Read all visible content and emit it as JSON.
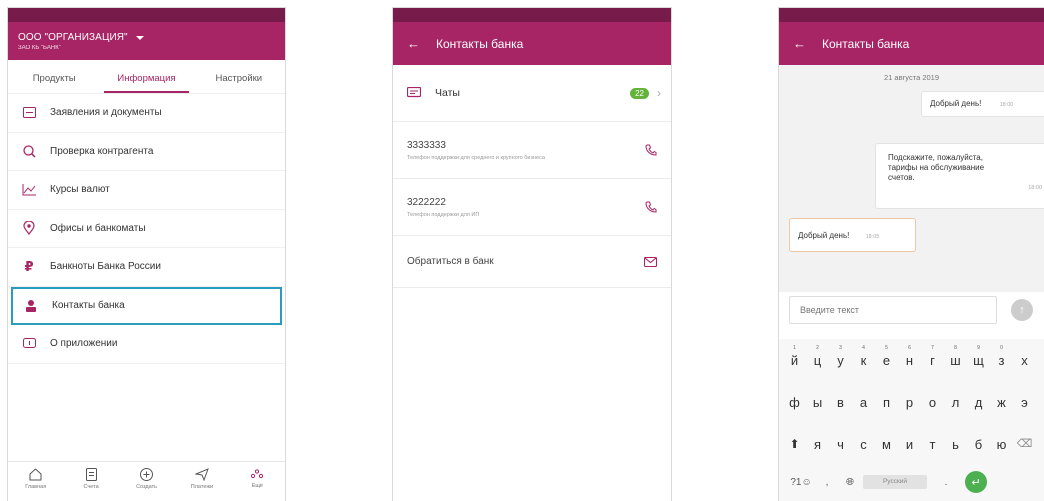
{
  "colors": {
    "brand": "#a82565",
    "statusbar": "#761b4a",
    "selection": "#2a9cbf",
    "badge": "#64b33a"
  },
  "screen1": {
    "org": {
      "name": "ООО \"ОРГАНИЗАЦИЯ\"",
      "subtitle": "ЗАО КБ \"БАНК\""
    },
    "tabs": [
      {
        "label": "Продукты"
      },
      {
        "label": "Информация",
        "active": true
      },
      {
        "label": "Настройки"
      }
    ],
    "menu": [
      {
        "label": "Заявления и документы",
        "icon": "document-icon"
      },
      {
        "label": "Проверка контрагента",
        "icon": "search-check-icon"
      },
      {
        "label": "Курсы валют",
        "icon": "chart-icon"
      },
      {
        "label": "Офисы и банкоматы",
        "icon": "location-icon"
      },
      {
        "label": "Банкноты Банка России",
        "icon": "ruble-icon"
      },
      {
        "label": "Контакты банка",
        "icon": "contacts-icon",
        "selected": true
      },
      {
        "label": "О приложении",
        "icon": "info-icon"
      }
    ],
    "bottom_nav": [
      {
        "label": "Главная",
        "icon": "home-icon"
      },
      {
        "label": "Счета",
        "icon": "accounts-icon"
      },
      {
        "label": "Создать",
        "icon": "plus-circle-icon"
      },
      {
        "label": "Платежи",
        "icon": "send-icon"
      },
      {
        "label": "Ещё",
        "icon": "more-icon"
      }
    ]
  },
  "screen2": {
    "title": "Контакты банка",
    "chats": {
      "label": "Чаты",
      "count": "22"
    },
    "phones": [
      {
        "number": "3333333",
        "desc": "Телефон поддержки для среднего и крупного бизнеса"
      },
      {
        "number": "3222222",
        "desc": "Телефон поддержки для ИП"
      }
    ],
    "contact_bank": "Обратиться в банк"
  },
  "screen3": {
    "title": "Контакты банка",
    "date": "21 августа 2019",
    "messages": [
      {
        "text": "Добрый день!",
        "time": "18:00",
        "direction": "out"
      },
      {
        "text": "Подскажите, пожалуйста, тарифы на обслуживание счетов.",
        "time": "18:00",
        "direction": "out"
      },
      {
        "text": "Добрый день!",
        "time": "18:05",
        "direction": "in"
      }
    ],
    "input_placeholder": "Введите текст",
    "keyboard": {
      "row1": [
        "й",
        "ц",
        "у",
        "к",
        "е",
        "н",
        "г",
        "ш",
        "щ",
        "з",
        "х"
      ],
      "row1_hints": [
        "1",
        "2",
        "3",
        "4",
        "5",
        "6",
        "7",
        "8",
        "9",
        "0",
        ""
      ],
      "row2": [
        "ф",
        "ы",
        "в",
        "а",
        "п",
        "р",
        "о",
        "л",
        "д",
        "ж",
        "э"
      ],
      "row3": [
        "я",
        "ч",
        "с",
        "м",
        "и",
        "т",
        "ь",
        "б",
        "ю"
      ],
      "symbols_key": "?1☺",
      "comma": ",",
      "space": "Русский",
      "period": "."
    }
  }
}
